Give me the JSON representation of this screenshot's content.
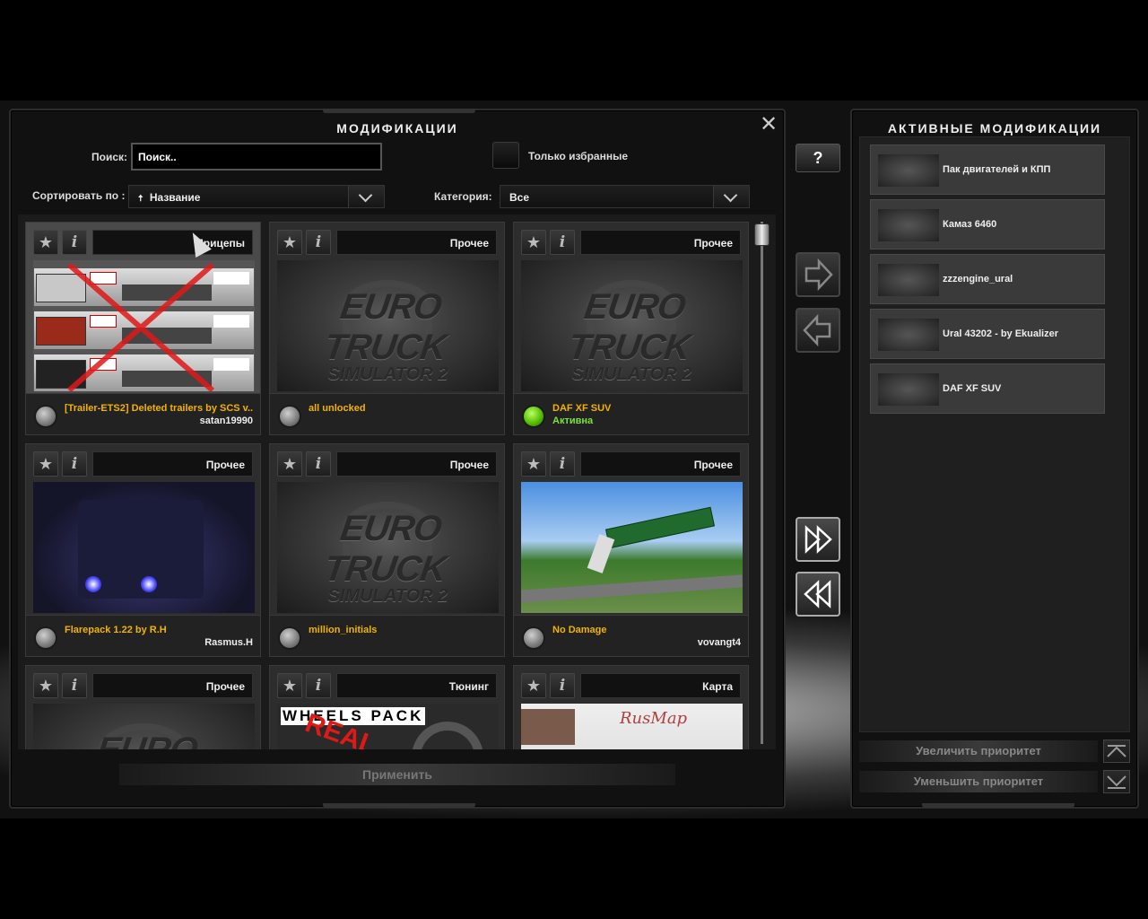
{
  "mods_panel": {
    "title": "МОДИФИКАЦИИ",
    "search_label": "Поиск:",
    "search_value": "Поиск..",
    "favorites_only_label": "Только избранные",
    "sort_label": "Сортировать по :",
    "sort_value": "Название",
    "sort_arrow_glyph": "🠅",
    "category_label": "Категория:",
    "category_value": "Все",
    "apply_label": "Применить"
  },
  "mods": [
    {
      "category": "Прицепы",
      "name": "[Trailer-ETS2] Deleted trailers by SCS v..",
      "author": "satan19990",
      "status": "",
      "active": false,
      "thumb": "trailers"
    },
    {
      "category": "Прочее",
      "name": "all unlocked",
      "author": "",
      "status": "",
      "active": false,
      "thumb": "ets"
    },
    {
      "category": "Прочее",
      "name": "DAF XF SUV",
      "author": "",
      "status": "Активна",
      "active": true,
      "thumb": "ets"
    },
    {
      "category": "Прочее",
      "name": "Flarepack 1.22 by R.H",
      "author": "Rasmus.H",
      "status": "",
      "active": false,
      "thumb": "night-truck"
    },
    {
      "category": "Прочее",
      "name": "million_initials",
      "author": "",
      "status": "",
      "active": false,
      "thumb": "ets"
    },
    {
      "category": "Прочее",
      "name": "No Damage",
      "author": "vovangt4",
      "status": "",
      "active": false,
      "thumb": "crash"
    },
    {
      "category": "Прочее",
      "name": "",
      "author": "",
      "status": "",
      "active": false,
      "thumb": "ets"
    },
    {
      "category": "Тюнинг",
      "name": "",
      "author": "",
      "status": "",
      "active": false,
      "thumb": "wheels",
      "thumb_text": "WHEELS PACK",
      "thumb_text2": "REAL"
    },
    {
      "category": "Карта",
      "name": "",
      "author": "",
      "status": "",
      "active": false,
      "thumb": "map",
      "thumb_text": "RusMap"
    }
  ],
  "ets_logo": {
    "line1": "EURO TRUCK",
    "line2": "SIMULATOR 2"
  },
  "active_panel": {
    "title": "АКТИВНЫЕ МОДИФИКАЦИИ",
    "items": [
      "Пак двигателей и КПП",
      "Камаз 6460",
      "zzzengine_ural",
      "Ural 43202 -  by Ekualizer",
      "DAF XF SUV"
    ],
    "increase_priority": "Увеличить приоритет",
    "decrease_priority": "Уменьшить приоритет"
  },
  "buttons": {
    "help": "?",
    "close": "✕"
  },
  "icons": {
    "star": "★",
    "info": "i"
  }
}
